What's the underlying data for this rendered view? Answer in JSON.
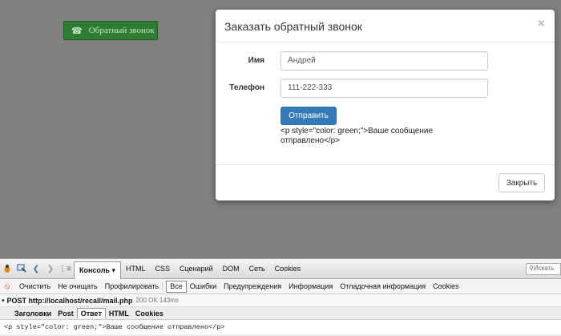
{
  "page": {
    "callback_button_label": "Обратный звонок",
    "callback_icon": "phone-icon"
  },
  "modal": {
    "title": "Заказать обратный звонок",
    "close_symbol": "×",
    "fields": [
      {
        "label": "Имя",
        "value": "Андрей"
      },
      {
        "label": "Телефон",
        "value": "111-222-333"
      }
    ],
    "submit_label": "Отправить",
    "response_text": "<p style=\"color: green;\">Ваше сообщение отправлено</p>",
    "close_button_label": "Закрыть",
    "accent_color": "#337ab7"
  },
  "firebug": {
    "tabs": [
      "Консоль ▾",
      "HTML",
      "CSS",
      "Сценарий",
      "DOM",
      "Сеть",
      "Cookies"
    ],
    "active_tab": "Консоль ▾",
    "search_placeholder": "Искать",
    "console_actions": [
      "Очистить",
      "Не очищать",
      "Профилировать"
    ],
    "filters": [
      "Все",
      "Ошибки",
      "Предупреждения",
      "Информация",
      "Отладочная информация",
      "Cookies"
    ],
    "active_filter": "Все",
    "request": {
      "method_url": "POST http://localhost/recall/mail.php",
      "status": "200 OK 143ms"
    },
    "subtabs": [
      "Заголовки",
      "Post",
      "Ответ",
      "HTML",
      "Cookies"
    ],
    "active_subtab": "Ответ",
    "response_body": "<p style=\"color: green;\">Ваше сообщение отправлено</p>"
  }
}
